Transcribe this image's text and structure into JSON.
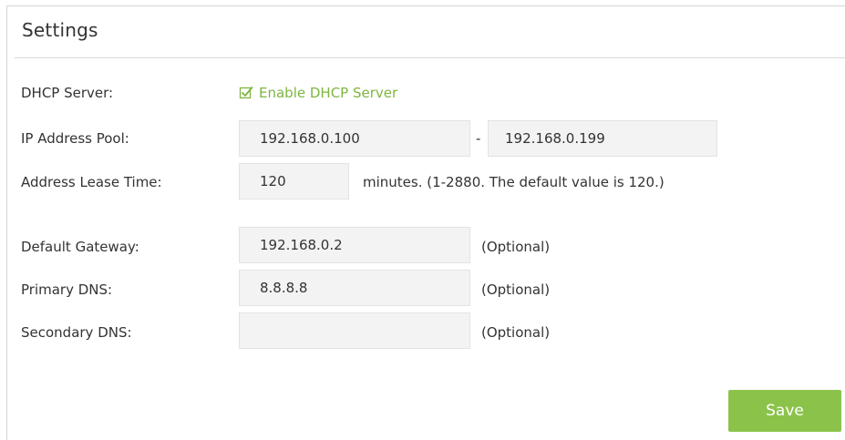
{
  "panel": {
    "title": "Settings"
  },
  "dhcp_server": {
    "label": "DHCP Server:",
    "checkbox_label": "Enable DHCP Server",
    "checked": true
  },
  "ip_pool": {
    "label": "IP Address Pool:",
    "start": "192.168.0.100",
    "separator": "-",
    "end": "192.168.0.199"
  },
  "lease_time": {
    "label": "Address Lease Time:",
    "value": "120",
    "hint": "minutes. (1-2880. The default value is 120.)"
  },
  "default_gateway": {
    "label": "Default Gateway:",
    "value": "192.168.0.2",
    "hint": "(Optional)"
  },
  "primary_dns": {
    "label": "Primary DNS:",
    "value": "8.8.8.8",
    "hint": "(Optional)"
  },
  "secondary_dns": {
    "label": "Secondary DNS:",
    "value": "",
    "hint": "(Optional)"
  },
  "actions": {
    "save_label": "Save"
  },
  "colors": {
    "accent": "#8bc34a",
    "checkbox_text": "#7db63f",
    "field_bg": "#f3f3f3"
  },
  "icons": {
    "checkbox": "checkbox-checked-icon"
  }
}
